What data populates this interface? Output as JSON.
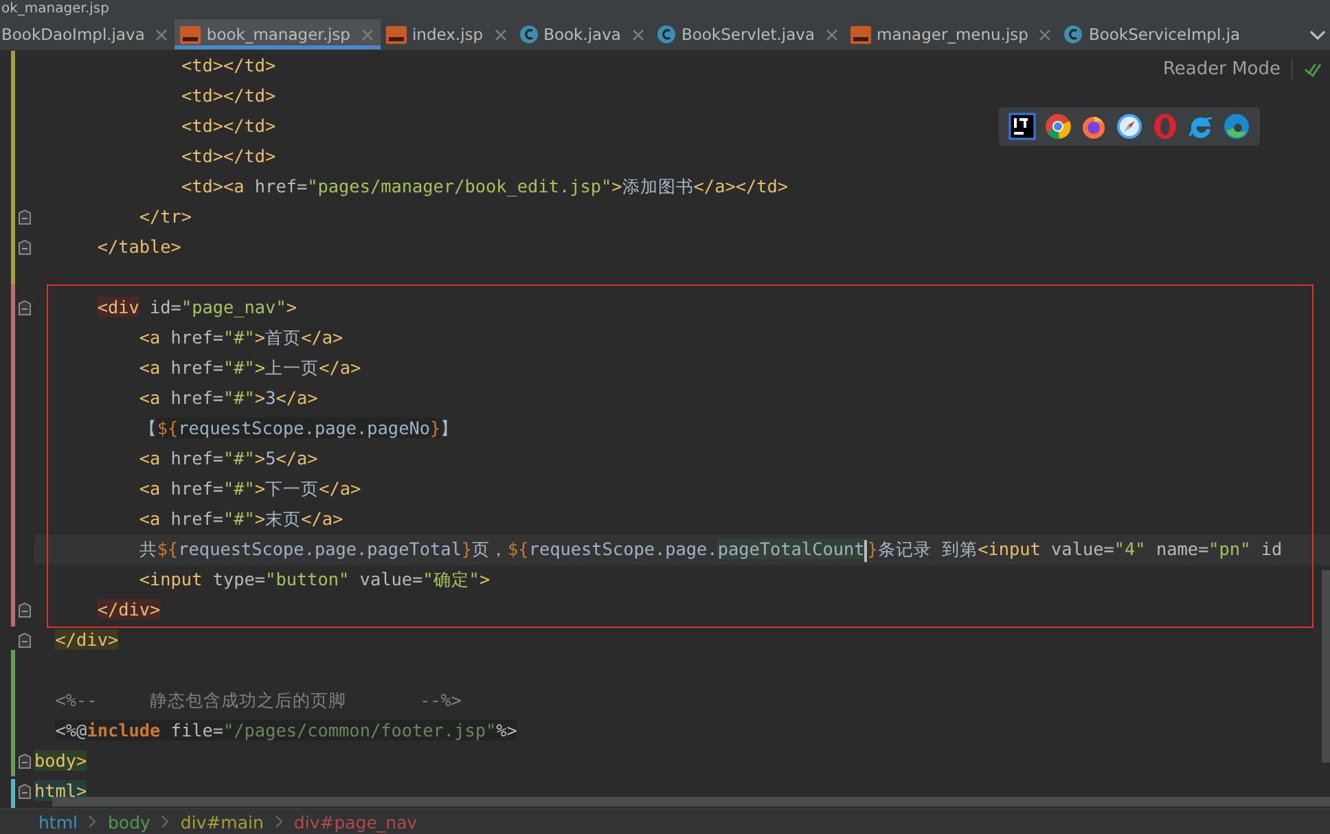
{
  "window": {
    "title": "ok_manager.jsp"
  },
  "tabs": [
    {
      "label": "BookDaoImpl.java",
      "kind": "plain",
      "selected": false,
      "close": true
    },
    {
      "label": "book_manager.jsp",
      "kind": "jsp",
      "selected": true,
      "close": true
    },
    {
      "label": "index.jsp",
      "kind": "jsp",
      "selected": false,
      "close": true
    },
    {
      "label": "Book.java",
      "kind": "class",
      "selected": false,
      "close": true
    },
    {
      "label": "BookServlet.java",
      "kind": "class",
      "selected": false,
      "close": true
    },
    {
      "label": "manager_menu.jsp",
      "kind": "jsp",
      "selected": false,
      "close": true
    },
    {
      "label": "BookServiceImpl.ja",
      "kind": "class",
      "selected": false,
      "close": false
    }
  ],
  "reader_mode": {
    "label": "Reader Mode"
  },
  "lines": [
    {
      "kind": "group",
      "children": [
        {
          "kind": "group",
          "children": [
            {
              "kind": "group",
              "children": [
                {
                  "kind": "code",
                  "fold": false,
                  "current": false,
                  "tokens": [
                    {
                      "kind": "tag",
                      "text": "<td></td>"
                    }
                  ]
                },
                {
                  "kind": "code",
                  "fold": false,
                  "current": false,
                  "tokens": [
                    {
                      "kind": "tag",
                      "text": "<td></td>"
                    }
                  ]
                },
                {
                  "kind": "code",
                  "fold": false,
                  "current": false,
                  "tokens": [
                    {
                      "kind": "tag",
                      "text": "<td></td>"
                    }
                  ]
                },
                {
                  "kind": "code",
                  "fold": false,
                  "current": false,
                  "tokens": [
                    {
                      "kind": "tag",
                      "text": "<td></td>"
                    }
                  ]
                },
                {
                  "kind": "code",
                  "fold": false,
                  "current": false,
                  "tokens": [
                    {
                      "kind": "tag",
                      "text": "<td><a"
                    },
                    {
                      "kind": "attr",
                      "text": " href="
                    },
                    {
                      "kind": "str",
                      "text": "\"pages/manager/book_edit.jsp\""
                    },
                    {
                      "kind": "tag",
                      "text": ">"
                    },
                    {
                      "kind": "text",
                      "text": "添加图书"
                    },
                    {
                      "kind": "tag",
                      "text": "</a></td>"
                    }
                  ]
                }
              ]
            },
            {
              "kind": "code",
              "fold": true,
              "current": false,
              "tokens": [
                {
                  "kind": "tag",
                  "text": "</tr>"
                }
              ]
            }
          ]
        },
        {
          "kind": "code",
          "fold": true,
          "current": false,
          "tokens": [
            {
              "kind": "tag",
              "text": "</table>"
            }
          ]
        },
        {
          "kind": "blank"
        },
        {
          "kind": "code",
          "fold": true,
          "current": false,
          "tokens": [
            {
              "kind": "tag",
              "text": "<div",
              "color": "#4a2828"
            },
            {
              "kind": "attr",
              "text": " id="
            },
            {
              "kind": "str",
              "text": "\"page_nav\""
            },
            {
              "kind": "tag",
              "text": ">"
            }
          ],
          "children": [
            {
              "kind": "code",
              "fold": false,
              "current": false,
              "tokens": [
                {
                  "kind": "tag",
                  "text": "<a"
                },
                {
                  "kind": "attr",
                  "text": " href="
                },
                {
                  "kind": "str",
                  "text": "\"#\""
                },
                {
                  "kind": "tag",
                  "text": ">"
                },
                {
                  "kind": "text",
                  "text": "首页"
                },
                {
                  "kind": "tag",
                  "text": "</a>"
                }
              ]
            },
            {
              "kind": "code",
              "fold": false,
              "current": false,
              "tokens": [
                {
                  "kind": "tag",
                  "text": "<a"
                },
                {
                  "kind": "attr",
                  "text": " href="
                },
                {
                  "kind": "str",
                  "text": "\"#\""
                },
                {
                  "kind": "tag",
                  "text": ">"
                },
                {
                  "kind": "text",
                  "text": "上一页"
                },
                {
                  "kind": "tag",
                  "text": "</a>"
                }
              ]
            },
            {
              "kind": "code",
              "fold": false,
              "current": false,
              "tokens": [
                {
                  "kind": "tag",
                  "text": "<a"
                },
                {
                  "kind": "attr",
                  "text": " href="
                },
                {
                  "kind": "str",
                  "text": "\"#\""
                },
                {
                  "kind": "tag",
                  "text": ">"
                },
                {
                  "kind": "text",
                  "text": "3"
                },
                {
                  "kind": "tag",
                  "text": "</a>"
                }
              ]
            },
            {
              "kind": "code",
              "fold": false,
              "current": false,
              "tokens": [
                {
                  "kind": "text",
                  "text": "【"
                },
                {
                  "kind": "brace",
                  "text": "${",
                  "color": "#232525"
                },
                {
                  "kind": "el",
                  "text": "requestScope.page.pageNo",
                  "color": "#232525"
                },
                {
                  "kind": "brace",
                  "text": "}",
                  "color": "#232525"
                },
                {
                  "kind": "text",
                  "text": "】"
                }
              ]
            },
            {
              "kind": "code",
              "fold": false,
              "current": false,
              "tokens": [
                {
                  "kind": "tag",
                  "text": "<a"
                },
                {
                  "kind": "attr",
                  "text": " href="
                },
                {
                  "kind": "str",
                  "text": "\"#\""
                },
                {
                  "kind": "tag",
                  "text": ">"
                },
                {
                  "kind": "text",
                  "text": "5"
                },
                {
                  "kind": "tag",
                  "text": "</a>"
                }
              ]
            },
            {
              "kind": "code",
              "fold": false,
              "current": false,
              "tokens": [
                {
                  "kind": "tag",
                  "text": "<a"
                },
                {
                  "kind": "attr",
                  "text": " href="
                },
                {
                  "kind": "str",
                  "text": "\"#\""
                },
                {
                  "kind": "tag",
                  "text": ">"
                },
                {
                  "kind": "text",
                  "text": "下一页"
                },
                {
                  "kind": "tag",
                  "text": "</a>"
                }
              ]
            },
            {
              "kind": "code",
              "fold": false,
              "current": false,
              "tokens": [
                {
                  "kind": "tag",
                  "text": "<a"
                },
                {
                  "kind": "attr",
                  "text": " href="
                },
                {
                  "kind": "str",
                  "text": "\"#\""
                },
                {
                  "kind": "tag",
                  "text": ">"
                },
                {
                  "kind": "text",
                  "text": "末页"
                },
                {
                  "kind": "tag",
                  "text": "</a>"
                }
              ]
            },
            {
              "kind": "code",
              "fold": false,
              "current": true,
              "tokens": [
                {
                  "kind": "text",
                  "text": "共"
                },
                {
                  "kind": "brace",
                  "text": "${"
                },
                {
                  "kind": "el",
                  "text": "requestScope.page.pageTotal"
                },
                {
                  "kind": "brace",
                  "text": "}"
                },
                {
                  "kind": "text",
                  "text": "页，"
                },
                {
                  "kind": "brace",
                  "text": "${"
                },
                {
                  "kind": "el",
                  "text": "requestScope.page."
                },
                {
                  "kind": "el",
                  "text": "pageTotalCount",
                  "color": "#344134"
                },
                {
                  "kind": "caret"
                },
                {
                  "kind": "brace",
                  "text": "}"
                },
                {
                  "kind": "text",
                  "text": "条记录 到第"
                },
                {
                  "kind": "tag",
                  "text": "<input"
                },
                {
                  "kind": "attr",
                  "text": " value="
                },
                {
                  "kind": "str",
                  "text": "\"4\""
                },
                {
                  "kind": "attr",
                  "text": " name="
                },
                {
                  "kind": "str",
                  "text": "\"pn\""
                },
                {
                  "kind": "attr",
                  "text": " id"
                }
              ]
            },
            {
              "kind": "code",
              "fold": false,
              "current": false,
              "tokens": [
                {
                  "kind": "tag",
                  "text": "<input"
                },
                {
                  "kind": "attr",
                  "text": " type="
                },
                {
                  "kind": "str",
                  "text": "\"button\""
                },
                {
                  "kind": "attr",
                  "text": " value="
                },
                {
                  "kind": "str",
                  "text": "\"确定\""
                },
                {
                  "kind": "tag",
                  "text": ">"
                }
              ]
            }
          ]
        },
        {
          "kind": "code",
          "fold": true,
          "current": false,
          "tokens": [
            {
              "kind": "tag",
              "text": "</div>",
              "color": "#4a2828"
            }
          ]
        }
      ]
    },
    {
      "kind": "code",
      "fold": true,
      "current": false,
      "tokens": [
        {
          "kind": "tag",
          "text": "</div>",
          "color": "#3d3b21"
        }
      ]
    },
    {
      "kind": "blank"
    },
    {
      "kind": "code",
      "fold": false,
      "current": false,
      "tokens": [
        {
          "kind": "comment",
          "text": "<%--     静态包含成功之后的页脚       --%>"
        }
      ]
    },
    {
      "kind": "code",
      "fold": false,
      "current": false,
      "tokens": [
        {
          "kind": "directive",
          "text": "<%@",
          "color": "#232525"
        },
        {
          "kind": "keyword",
          "text": "include",
          "color": "#232525"
        },
        {
          "kind": "attr",
          "text": " file=",
          "color": "#232525"
        },
        {
          "kind": "path",
          "text": "\"/pages/common/footer.jsp\"",
          "color": "#232525"
        },
        {
          "kind": "directive",
          "text": "%>",
          "color": "#232525"
        }
      ]
    },
    {
      "kind": "clipped",
      "fold": true,
      "current": false,
      "tokens": [
        {
          "kind": "tag",
          "text": "body>",
          "color": "#2e4227"
        }
      ]
    },
    {
      "kind": "clipped",
      "fold": true,
      "current": false,
      "tokens": [
        {
          "kind": "tag",
          "text": "html>",
          "color": "#23403d"
        }
      ]
    }
  ],
  "breadcrumbs": [
    {
      "label": "html",
      "color": "#3f8fb8"
    },
    {
      "label": "body",
      "color": "#4e9a4e"
    },
    {
      "label": "div#main",
      "color": "#a8a032"
    },
    {
      "label": "div#page_nav",
      "color": "#b34a48"
    }
  ]
}
